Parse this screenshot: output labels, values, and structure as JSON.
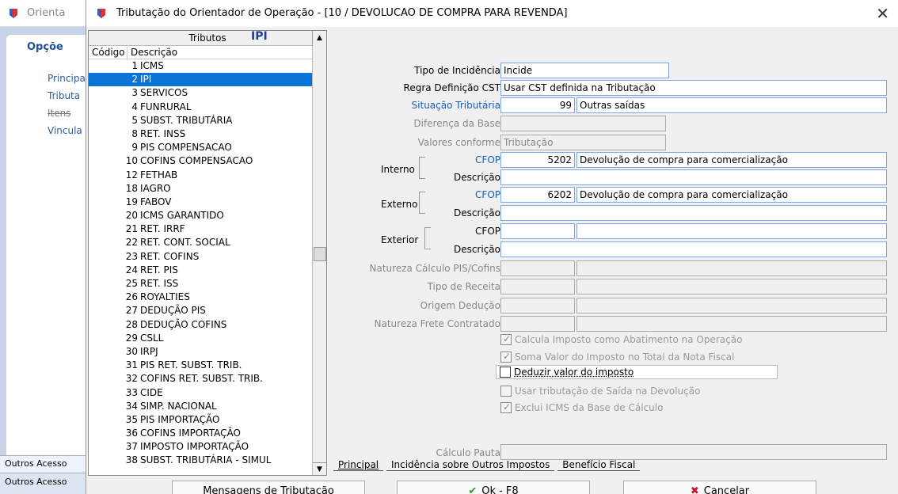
{
  "background_app": {
    "title": "Orienta",
    "section": "Opçõe",
    "items": [
      "Principa",
      "Tributa",
      "Itens",
      "Vincula"
    ],
    "footer1": "Outros Acesso",
    "footer2": "Outros Acesso"
  },
  "dialog": {
    "title": "Tributação do Orientador de Operação - [10 / DEVOLUCAO DE COMPRA PARA REVENDA]",
    "close_glyph": "✕"
  },
  "tributos": {
    "header": "Tributos",
    "col_code": "Código",
    "col_desc": "Descrição",
    "selected_index": 1,
    "rows": [
      {
        "code": "1",
        "desc": "ICMS"
      },
      {
        "code": "2",
        "desc": "IPI"
      },
      {
        "code": "3",
        "desc": "SERVICOS"
      },
      {
        "code": "4",
        "desc": "FUNRURAL"
      },
      {
        "code": "5",
        "desc": "SUBST. TRIBUTÁRIA"
      },
      {
        "code": "8",
        "desc": "RET. INSS"
      },
      {
        "code": "9",
        "desc": "PIS COMPENSACAO"
      },
      {
        "code": "10",
        "desc": "COFINS COMPENSACAO"
      },
      {
        "code": "12",
        "desc": "FETHAB"
      },
      {
        "code": "18",
        "desc": "IAGRO"
      },
      {
        "code": "19",
        "desc": "FABOV"
      },
      {
        "code": "20",
        "desc": "ICMS GARANTIDO"
      },
      {
        "code": "21",
        "desc": "RET. IRRF"
      },
      {
        "code": "22",
        "desc": "RET. CONT. SOCIAL"
      },
      {
        "code": "23",
        "desc": "RET. COFINS"
      },
      {
        "code": "24",
        "desc": "RET. PIS"
      },
      {
        "code": "25",
        "desc": "RET. ISS"
      },
      {
        "code": "26",
        "desc": "ROYALTIES"
      },
      {
        "code": "27",
        "desc": "DEDUÇÃO PIS"
      },
      {
        "code": "28",
        "desc": "DEDUÇÃO COFINS"
      },
      {
        "code": "29",
        "desc": "CSLL"
      },
      {
        "code": "30",
        "desc": "IRPJ"
      },
      {
        "code": "31",
        "desc": "PIS RET. SUBST. TRIB."
      },
      {
        "code": "32",
        "desc": "COFINS RET. SUBST. TRIB."
      },
      {
        "code": "33",
        "desc": "CIDE"
      },
      {
        "code": "34",
        "desc": "SIMP. NACIONAL"
      },
      {
        "code": "35",
        "desc": "PIS IMPORTAÇÃO"
      },
      {
        "code": "36",
        "desc": "COFINS IMPORTAÇÃO"
      },
      {
        "code": "37",
        "desc": "IMPOSTO IMPORTAÇÃO"
      },
      {
        "code": "38",
        "desc": "SUBST. TRIBUTÁRIA - SIMUL"
      }
    ]
  },
  "form": {
    "section_title": "IPI",
    "tipo_incidencia": {
      "label": "Tipo de Incidência",
      "value": "Incide"
    },
    "regra_cst": {
      "label": "Regra Definição CST",
      "value": "Usar CST definida na Tributação"
    },
    "situacao": {
      "label": "Situação Tributária",
      "code": "99",
      "value": "Outras saídas"
    },
    "diferenca_base": {
      "label": "Diferença da Base",
      "value": ""
    },
    "valores_conforme": {
      "label": "Valores conforme",
      "value": "Tributação"
    },
    "interno": {
      "label": "Interno",
      "cfop_label": "CFOP",
      "cfop": "5202",
      "cfop_desc": "Devolução de compra para comercialização",
      "desc_label": "Descrição",
      "desc": ""
    },
    "externo": {
      "label": "Externo",
      "cfop_label": "CFOP",
      "cfop": "6202",
      "cfop_desc": "Devolução de compra para comercialização",
      "desc_label": "Descrição",
      "desc": ""
    },
    "exterior": {
      "label": "Exterior",
      "cfop_label": "CFOP",
      "cfop": "",
      "cfop_desc": "",
      "desc_label": "Descrição",
      "desc": ""
    },
    "natureza_pis": {
      "label": "Natureza Cálculo PIS/Cofins"
    },
    "tipo_receita": {
      "label": "Tipo de Receita"
    },
    "origem_deducao": {
      "label": "Origem Dedução"
    },
    "natureza_frete": {
      "label": "Natureza Frete Contratado"
    },
    "checks": [
      {
        "label": "Calcula Imposto como Abatimento na Operação",
        "checked": true,
        "enabled": false
      },
      {
        "label": "Soma Valor do Imposto no Total da Nota Fiscal",
        "checked": true,
        "enabled": false
      },
      {
        "label": "Deduzir valor do imposto",
        "checked": false,
        "enabled": true
      },
      {
        "label": "Usar tributação de Saída na Devolução",
        "checked": false,
        "enabled": false
      },
      {
        "label": "Exclui ICMS da Base de Cálculo",
        "checked": true,
        "enabled": false
      }
    ],
    "calculo_pauta": {
      "label": "Cálculo Pauta",
      "value": ""
    }
  },
  "tabs": [
    "Principal",
    "Incidência sobre  Outros Impostos",
    "Benefício Fiscal"
  ],
  "buttons": {
    "mensagens": "Mensagens de Tributação",
    "ok": "Ok - F8",
    "cancelar": "Cancelar"
  },
  "colors": {
    "selection": "#0a74d9",
    "accent_blue": "#1a5fb4",
    "ok_green": "#1f9d2e",
    "cancel_red": "#c8102e"
  }
}
